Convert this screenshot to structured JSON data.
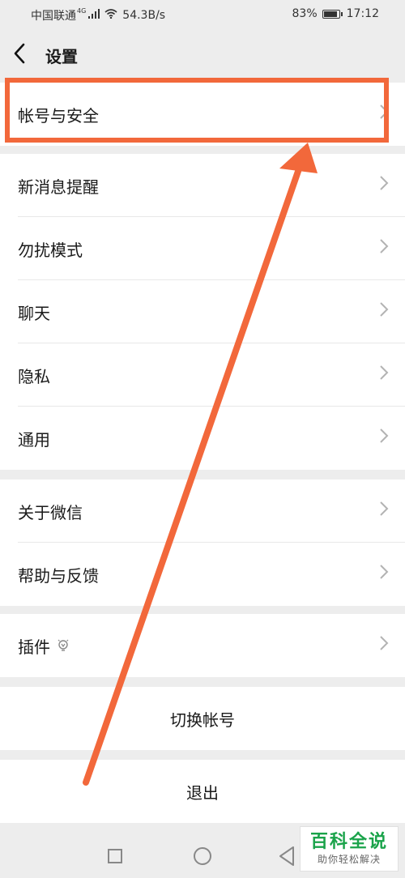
{
  "status_bar": {
    "carrier": "中国联通",
    "network": "4G",
    "speed": "54.3B/s",
    "battery": "83%",
    "time": "17:12"
  },
  "header": {
    "title": "设置"
  },
  "groups": [
    {
      "items": [
        {
          "label": "帐号与安全"
        }
      ]
    },
    {
      "items": [
        {
          "label": "新消息提醒"
        },
        {
          "label": "勿扰模式"
        },
        {
          "label": "聊天"
        },
        {
          "label": "隐私"
        },
        {
          "label": "通用"
        }
      ]
    },
    {
      "items": [
        {
          "label": "关于微信"
        },
        {
          "label": "帮助与反馈"
        }
      ]
    },
    {
      "items": [
        {
          "label": "插件"
        }
      ]
    }
  ],
  "actions": {
    "switch_account": "切换帐号",
    "logout": "退出"
  },
  "watermark": {
    "title": "百科全说",
    "subtitle": "助你轻松解决"
  },
  "colors": {
    "annotation": "#f2683b",
    "watermark_green": "#1aa34a"
  }
}
